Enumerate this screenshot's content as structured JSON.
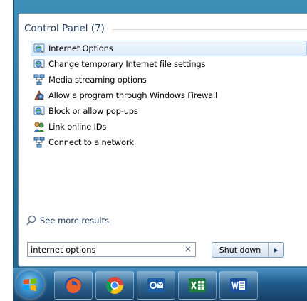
{
  "section": {
    "title": "Control Panel (7)"
  },
  "results": [
    {
      "label": "Internet Options",
      "icon": "internet-options-icon",
      "selected": true
    },
    {
      "label": "Change temporary Internet file settings",
      "icon": "internet-options-icon"
    },
    {
      "label": "Media streaming options",
      "icon": "network-icon"
    },
    {
      "label": "Allow a program through Windows Firewall",
      "icon": "firewall-icon"
    },
    {
      "label": "Block or allow pop-ups",
      "icon": "internet-options-icon"
    },
    {
      "label": "Link online IDs",
      "icon": "users-icon"
    },
    {
      "label": "Connect to a network",
      "icon": "network-icon"
    }
  ],
  "see_more": {
    "label": "See more results",
    "icon": "search-icon"
  },
  "search": {
    "value": "internet options",
    "clear_glyph": "×"
  },
  "shutdown": {
    "label": "Shut down",
    "arrow": "▶"
  },
  "taskbar": {
    "items": [
      {
        "name": "start-orb",
        "icon": "windows-orb-icon"
      },
      {
        "name": "firefox",
        "icon": "firefox-icon"
      },
      {
        "name": "chrome",
        "icon": "chrome-icon"
      },
      {
        "name": "outlook",
        "icon": "outlook-icon"
      },
      {
        "name": "excel",
        "icon": "excel-icon"
      },
      {
        "name": "word",
        "icon": "word-icon"
      }
    ]
  },
  "colors": {
    "accent": "#1e395b",
    "selection": "#dcebfc",
    "taskbar": "#1f5c8c"
  }
}
